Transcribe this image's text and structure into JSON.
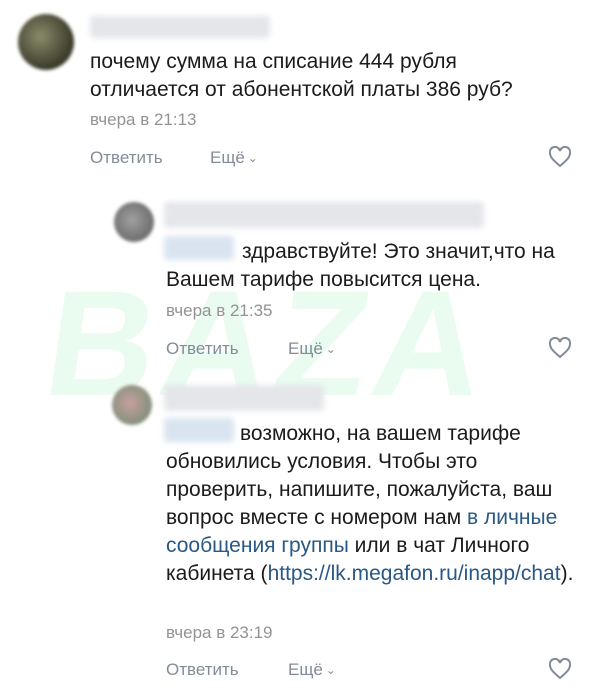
{
  "watermark": "BAZA",
  "comments": [
    {
      "text": "почему сумма на списание 444 рубля отличается от абонентской платы 386 руб?",
      "time": "вчера в 21:13",
      "reply_label": "Ответить",
      "more_label": "Ещё"
    },
    {
      "text": "здравствуйте! Это значит,что на Вашем тарифе повысится цена.",
      "time": "вчера в 21:35",
      "reply_label": "Ответить",
      "more_label": "Ещё"
    },
    {
      "text_before": "возможно, на вашем тарифе обновились условия. Чтобы это проверить, напишите, пожалуйста, ваш вопрос вместе с номером нам ",
      "link1": "в личные сообщения группы",
      "text_middle": " или в чат Личного кабинета (",
      "link2": "https://lk.megafon.ru/inapp/chat",
      "text_after": ").",
      "time": "вчера в 23:19",
      "reply_label": "Ответить",
      "more_label": "Ещё"
    }
  ],
  "icons": {
    "like": "heart-outline-icon",
    "more_chevron": "chevron-down-icon"
  },
  "colors": {
    "link": "#2a5885",
    "meta": "#939393",
    "action": "#818c99"
  }
}
